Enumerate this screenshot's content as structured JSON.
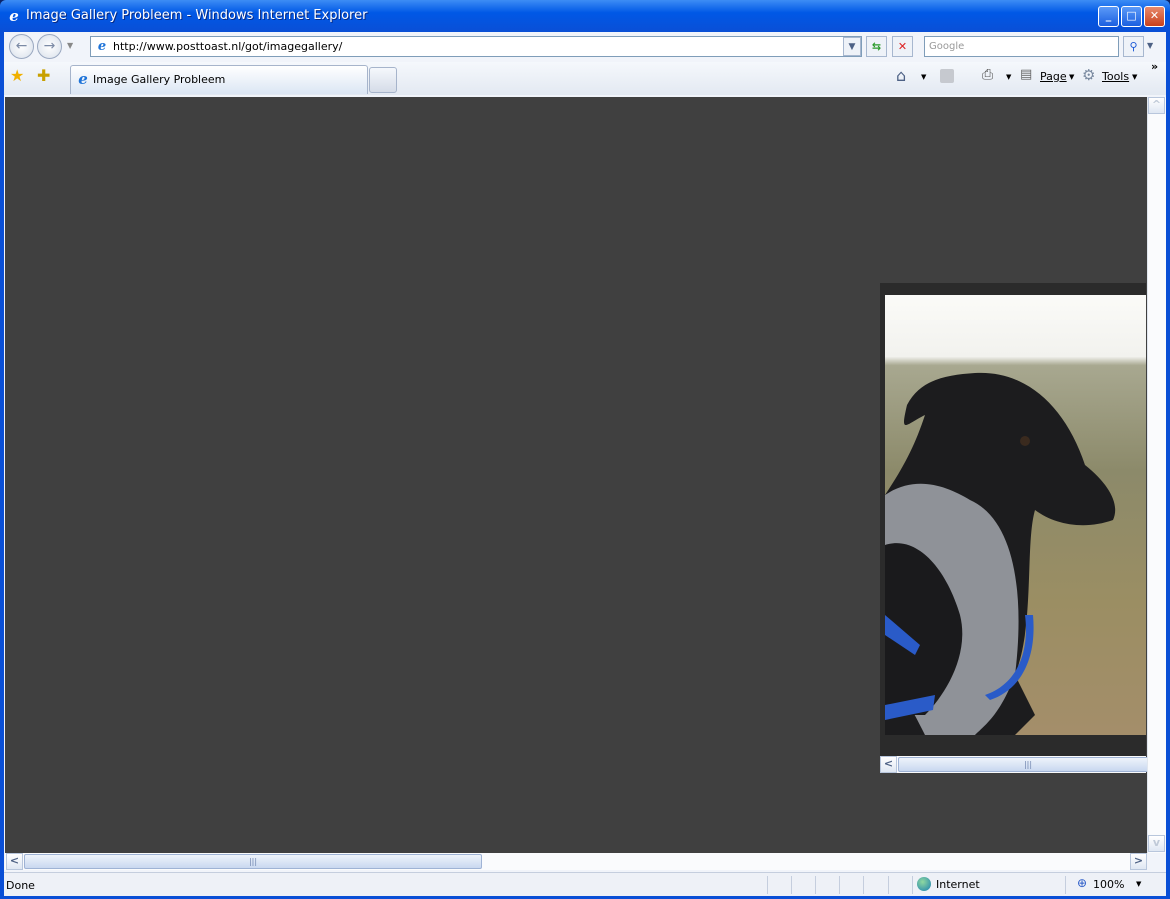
{
  "window": {
    "title": "Image Gallery Probleem - Windows Internet Explorer"
  },
  "address": {
    "url": "http://www.posttoast.nl/got/imagegallery/"
  },
  "search": {
    "placeholder": "Google"
  },
  "tab": {
    "label": "Image Gallery Probleem"
  },
  "toolbar": {
    "page_label": "Page",
    "tools_label": "Tools",
    "chevron": "»"
  },
  "status": {
    "text": "Done",
    "zone": "Internet",
    "zoom": "100%"
  }
}
